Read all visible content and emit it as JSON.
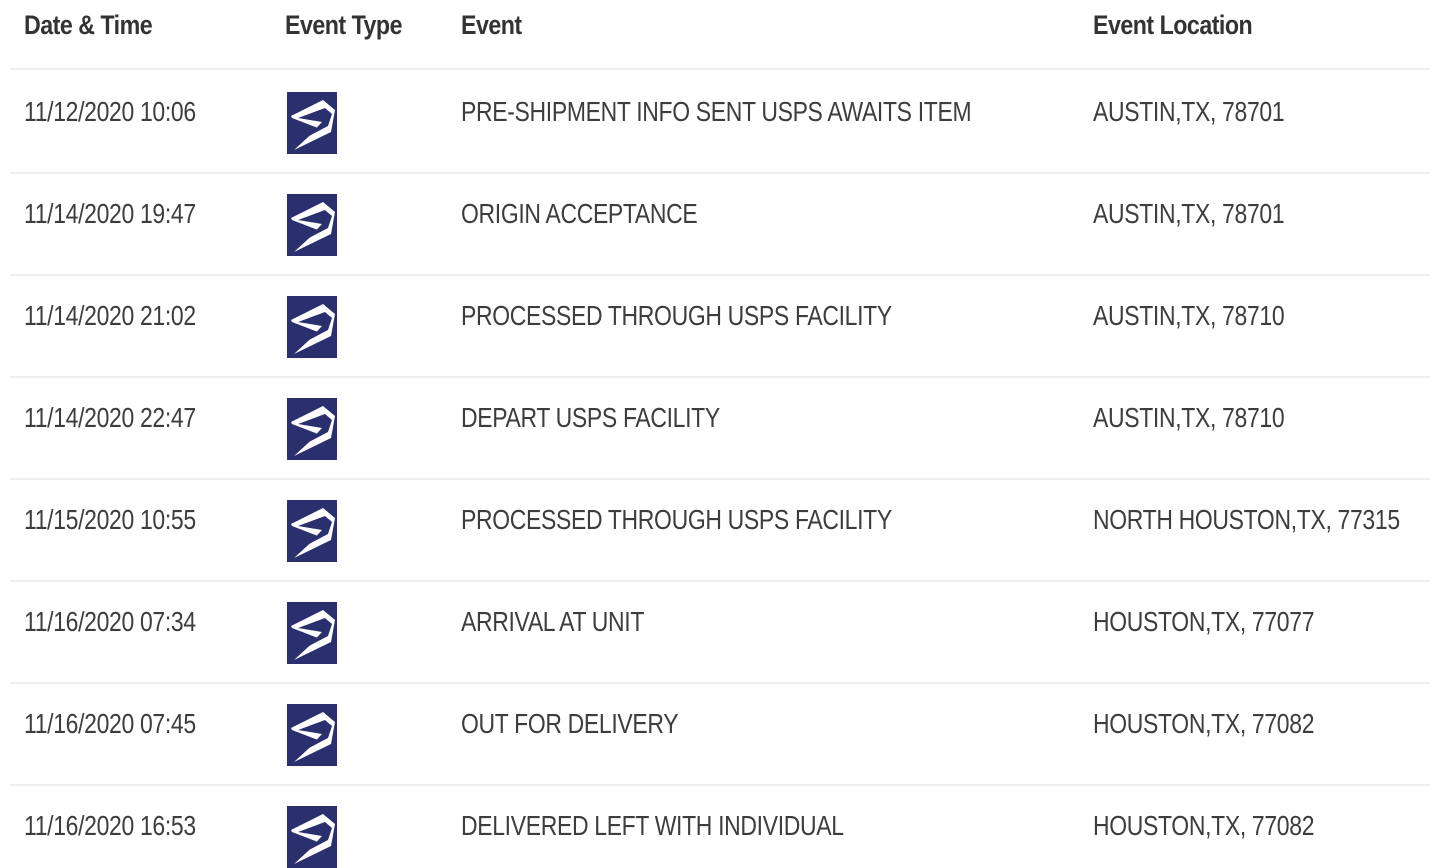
{
  "table": {
    "headers": {
      "date_time": "Date & Time",
      "event_type": "Event Type",
      "event": "Event",
      "event_location": "Event Location"
    },
    "icon": "usps-eagle-icon",
    "icon_colors": {
      "background": "#2a2f6d",
      "mark": "#ffffff"
    },
    "rows": [
      {
        "date_time": "11/12/2020 10:06",
        "event": "PRE-SHIPMENT INFO SENT USPS AWAITS ITEM",
        "location": "AUSTIN,TX, 78701"
      },
      {
        "date_time": "11/14/2020 19:47",
        "event": "ORIGIN ACCEPTANCE",
        "location": "AUSTIN,TX, 78701"
      },
      {
        "date_time": "11/14/2020 21:02",
        "event": "PROCESSED THROUGH USPS FACILITY",
        "location": "AUSTIN,TX, 78710"
      },
      {
        "date_time": "11/14/2020 22:47",
        "event": "DEPART USPS FACILITY",
        "location": "AUSTIN,TX, 78710"
      },
      {
        "date_time": "11/15/2020 10:55",
        "event": "PROCESSED THROUGH USPS FACILITY",
        "location": "NORTH HOUSTON,TX, 77315"
      },
      {
        "date_time": "11/16/2020 07:34",
        "event": "ARRIVAL AT UNIT",
        "location": "HOUSTON,TX, 77077"
      },
      {
        "date_time": "11/16/2020 07:45",
        "event": "OUT FOR DELIVERY",
        "location": "HOUSTON,TX, 77082"
      },
      {
        "date_time": "11/16/2020 16:53",
        "event": "DELIVERED LEFT WITH INDIVIDUAL",
        "location": "HOUSTON,TX, 77082"
      }
    ]
  }
}
